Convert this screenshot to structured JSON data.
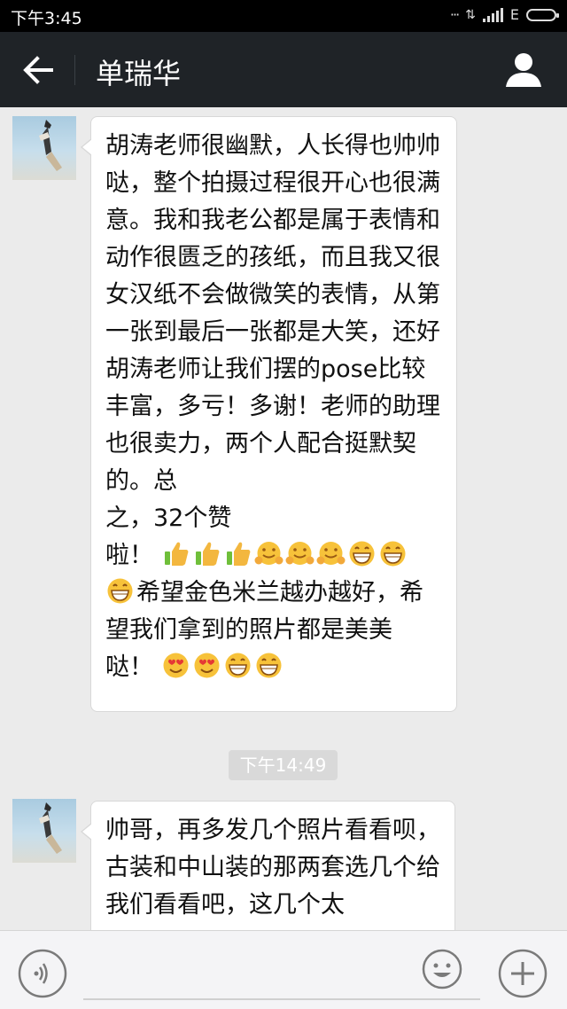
{
  "status_bar": {
    "time": "下午3:45",
    "network": "E"
  },
  "header": {
    "title": "单瑞华",
    "back_icon": "arrow-left-icon",
    "contact_icon": "person-icon"
  },
  "messages": [
    {
      "sender": "单瑞华",
      "text_a": "胡涛老师很幽默，人长得也帅帅哒，整个拍摄过程很开心也很满意。我和我老公都是属于表情和动作很匮乏的孩纸，而且我又很女汉纸不会做微笑的表情，从第一张到最后一张都是大笑，还好胡涛老师让我们摆的pose比较丰富，多亏！多谢！老师的助理也很卖力，两个人配合挺默契的。总",
      "text_b": "之，32个赞",
      "text_c": "啦！",
      "text_d": "希望金色米兰越办越好，希望我们拿到的照片都是美美",
      "text_e": "哒！",
      "emoji_row1": [
        "thumbs-up-icon",
        "thumbs-up-icon",
        "thumbs-up-icon",
        "hug-emoji-icon",
        "hug-emoji-icon",
        "hug-emoji-icon",
        "grin-emoji-icon",
        "grin-emoji-icon"
      ],
      "emoji_row2": [
        "grin-emoji-icon"
      ],
      "emoji_row3": [
        "heart-eyes-emoji-icon",
        "heart-eyes-emoji-icon",
        "grin-emoji-icon",
        "grin-emoji-icon"
      ]
    },
    {
      "sender": "单瑞华",
      "text": "帅哥，再多发几个照片看看呗，古装和中山装的那两套选几个给我们看看吧，这几个太"
    }
  ],
  "timestamp": "下午14:49",
  "input_bar": {
    "voice_icon": "voice-icon",
    "emoji_icon": "smiley-icon",
    "plus_icon": "plus-icon"
  }
}
